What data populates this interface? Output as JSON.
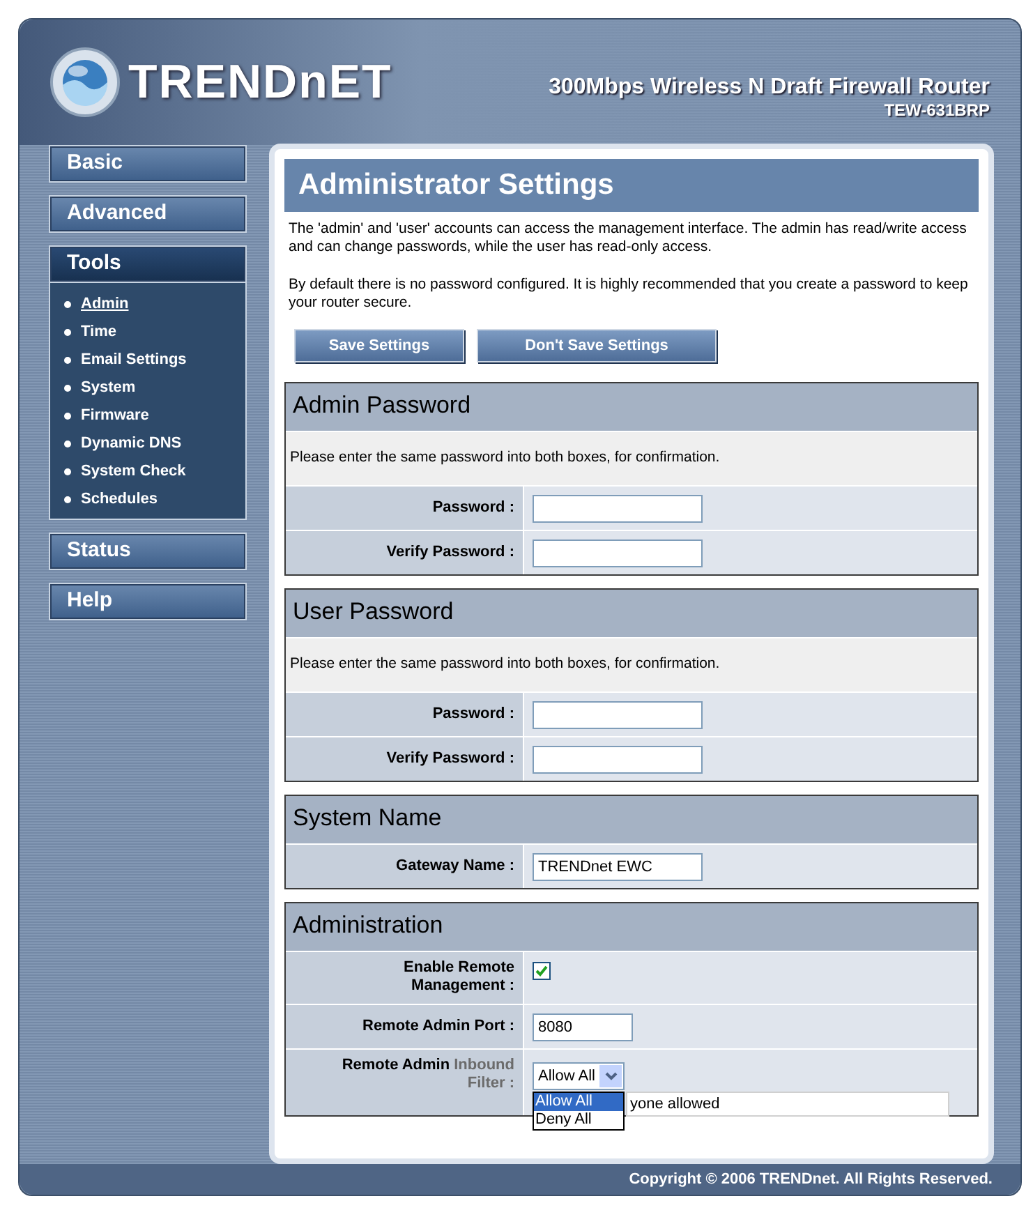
{
  "header": {
    "brand": "TRENDnET",
    "product": "300Mbps Wireless N Draft Firewall Router",
    "model": "TEW-631BRP"
  },
  "sidebar": [
    {
      "label": "Basic",
      "expanded": false
    },
    {
      "label": "Advanced",
      "expanded": false
    },
    {
      "label": "Tools",
      "expanded": true,
      "children": [
        {
          "label": "Admin",
          "selected": true
        },
        {
          "label": "Time",
          "selected": false
        },
        {
          "label": "Email Settings",
          "selected": false
        },
        {
          "label": "System",
          "selected": false
        },
        {
          "label": "Firmware",
          "selected": false
        },
        {
          "label": "Dynamic DNS",
          "selected": false
        },
        {
          "label": "System Check",
          "selected": false
        },
        {
          "label": "Schedules",
          "selected": false
        }
      ]
    },
    {
      "label": "Status",
      "expanded": false
    },
    {
      "label": "Help",
      "expanded": false
    }
  ],
  "page": {
    "title": "Administrator Settings",
    "paragraphs": [
      "The 'admin' and 'user' accounts can access the management interface. The admin has read/write access and can change passwords, while the user has read-only access.",
      "By default there is no password configured. It is highly recommended that you create a password to keep your router secure."
    ],
    "buttons": [
      "Save Settings",
      "Don't Save Settings"
    ]
  },
  "sections": [
    {
      "title": "Admin Password",
      "description": "Please enter the same password into both boxes, for confirmation.",
      "rows": [
        {
          "kind": "password",
          "label": "Password :"
        },
        {
          "kind": "password",
          "label": "Verify Password :"
        }
      ]
    },
    {
      "title": "User Password",
      "description": "Please enter the same password into both boxes, for confirmation.",
      "rows": [
        {
          "kind": "password",
          "label": "Password :"
        },
        {
          "kind": "password",
          "label": "Verify Password :"
        }
      ]
    },
    {
      "title": "System Name",
      "rows": [
        {
          "kind": "text",
          "label": "Gateway Name :",
          "value": "TRENDnet EWC"
        }
      ]
    },
    {
      "title": "Administration",
      "rows": [
        {
          "kind": "checkbox",
          "label": "Enable Remote Management :",
          "checked": true
        },
        {
          "kind": "text",
          "label": "Remote Admin Port :",
          "value": "8080"
        },
        {
          "kind": "select",
          "label": "Remote Admin",
          "label_dim": "Inbound Filter :",
          "value": "Allow All",
          "options": [
            {
              "label": "Allow All",
              "selected": true
            },
            {
              "label": "Deny All",
              "selected": false
            }
          ],
          "detail": "yone allowed"
        }
      ]
    }
  ],
  "footer": "Copyright © 2006 TRENDnet. All Rights Reserved."
}
